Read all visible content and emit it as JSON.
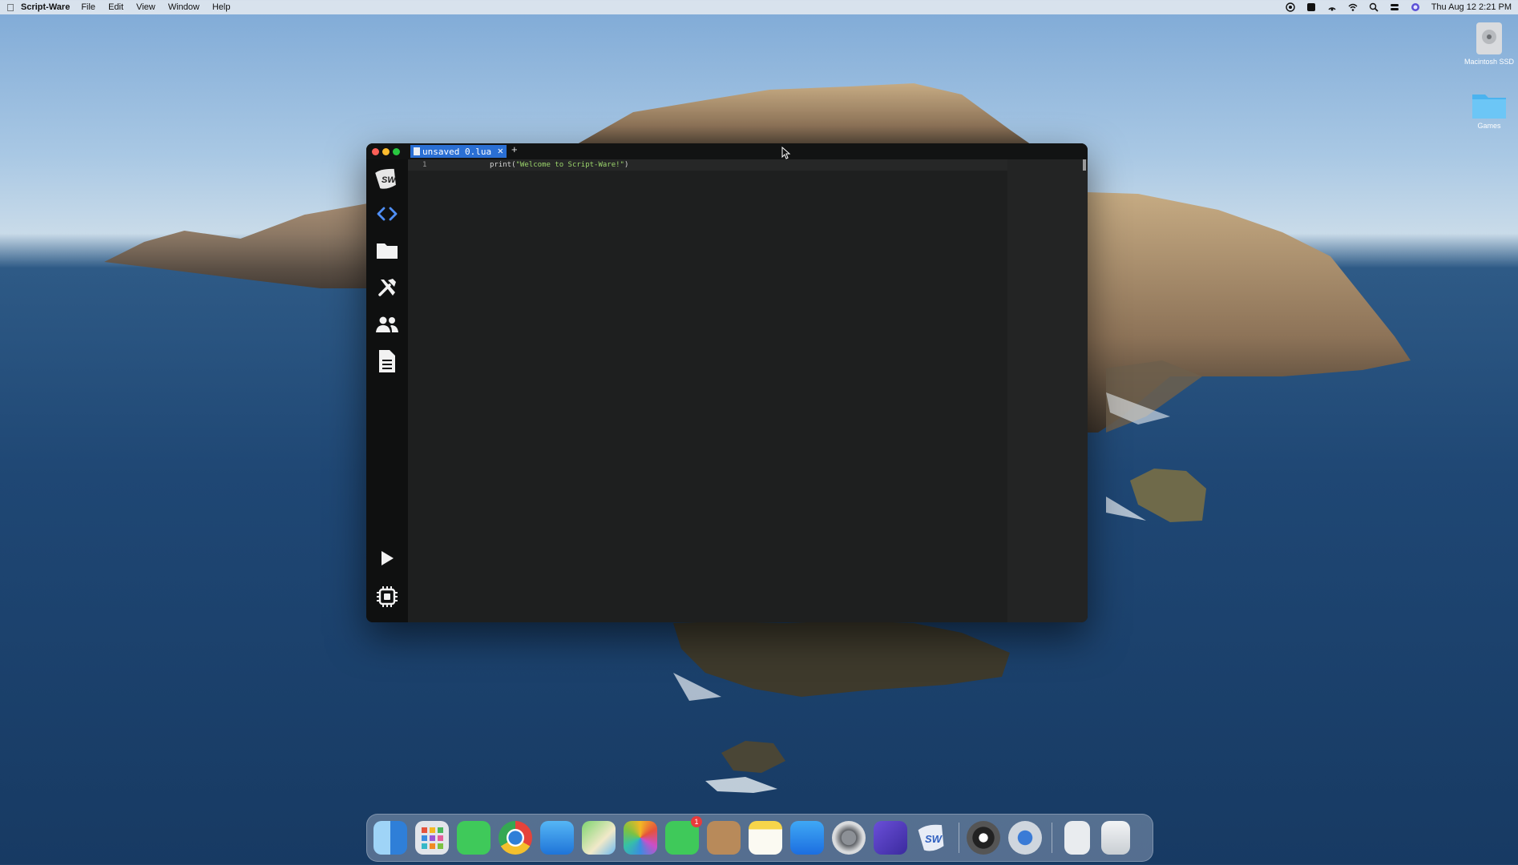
{
  "menubar": {
    "app_name": "Script-Ware",
    "menus": [
      "File",
      "Edit",
      "View",
      "Window",
      "Help"
    ],
    "clock": "Thu Aug 12  2:21 PM",
    "status_icons": [
      "screen-record-icon",
      "control-icon",
      "airdrop-icon",
      "wifi-icon",
      "search-icon",
      "control-center-icon",
      "siri-icon"
    ]
  },
  "desktop": {
    "icons": [
      {
        "name": "drive-icon",
        "label": "Macintosh SSD"
      },
      {
        "name": "folder-icon",
        "label": "Games"
      }
    ]
  },
  "window": {
    "tab": {
      "label": "unsaved 0.lua",
      "close": "✕"
    },
    "new_tab": "+",
    "sidebar": {
      "items": [
        "logo-icon",
        "code-icon",
        "folder-icon",
        "tools-icon",
        "users-icon",
        "document-icon"
      ],
      "bottom": [
        "run-icon",
        "settings-chip-icon"
      ],
      "active_color": "#4f8ff7"
    },
    "editor": {
      "line_number": "1",
      "code_prefix": "print(",
      "code_string": "\"Welcome to Script-Ware!\"",
      "code_suffix": ")"
    }
  },
  "dock": {
    "apps": [
      "finder-icon",
      "launchpad-icon",
      "messages-icon",
      "chrome-icon",
      "mail-icon",
      "maps-icon",
      "photos-icon",
      "facetime-icon",
      "contacts-icon",
      "notes-icon",
      "app-store-icon",
      "system-preferences-icon",
      "imovie-icon",
      "script-ware-icon",
      "obs-icon",
      "quicktime-icon",
      "downloads-icon",
      "trash-icon"
    ],
    "facetime_badge": "1"
  }
}
